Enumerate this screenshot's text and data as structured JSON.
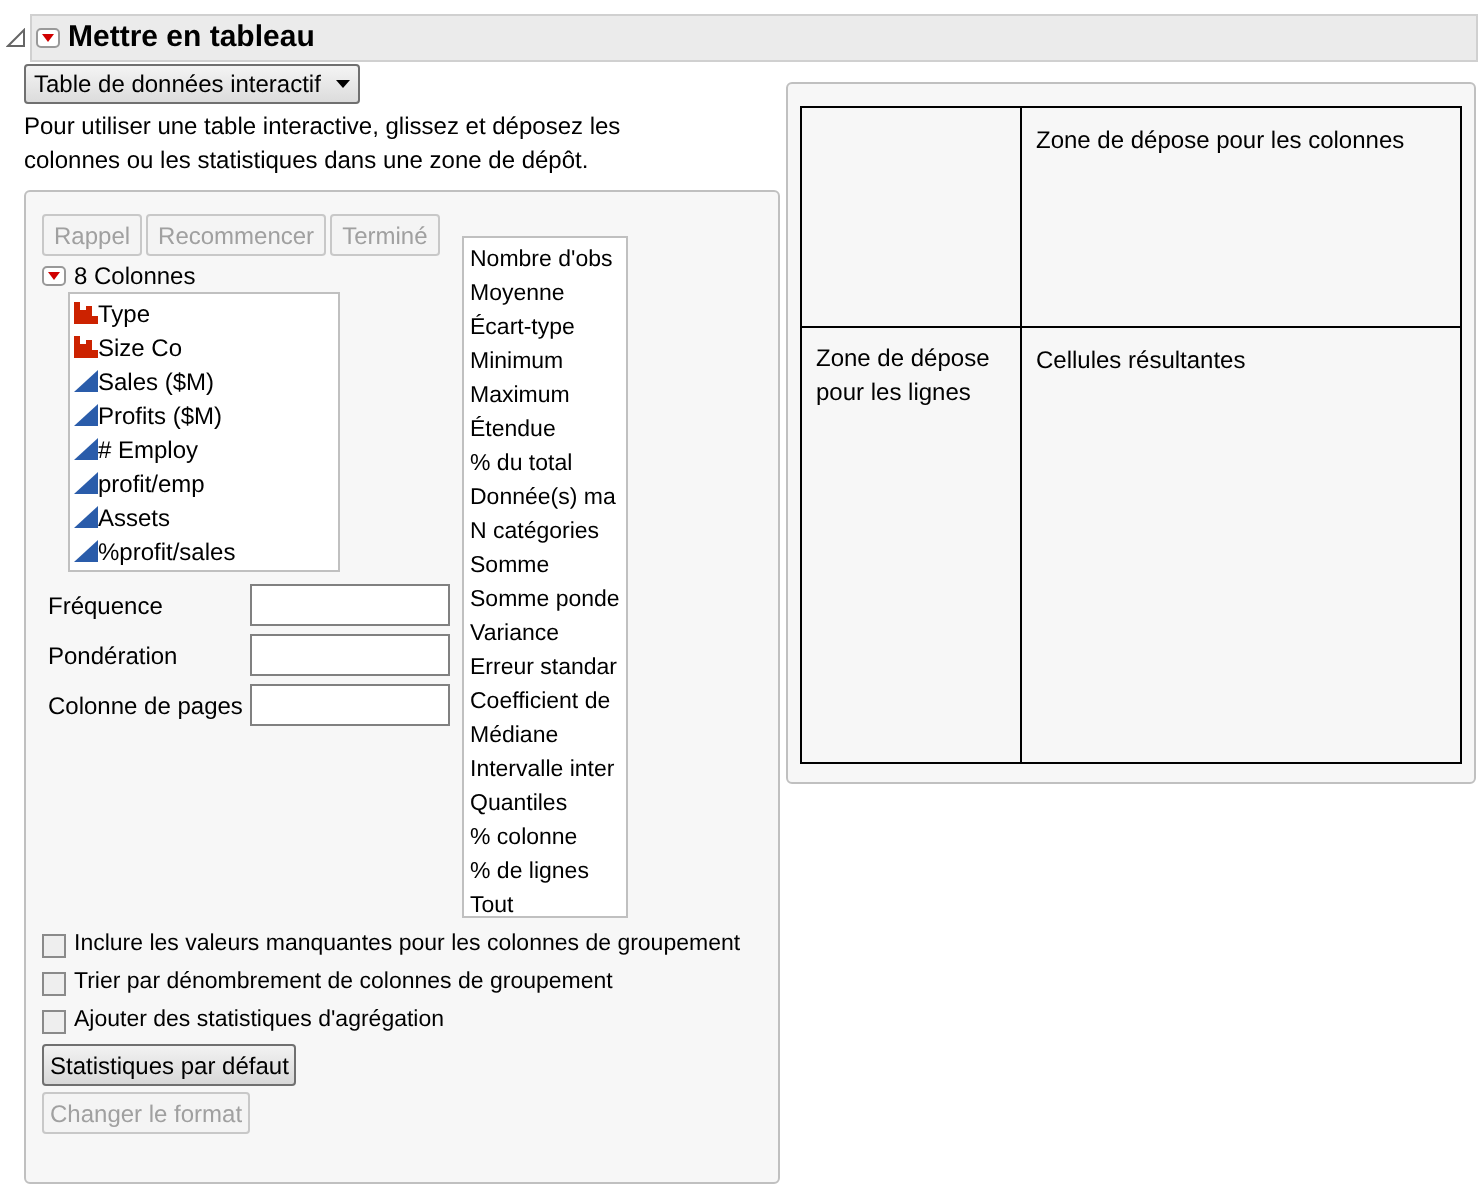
{
  "title": "Mettre en tableau",
  "mode_dropdown": {
    "value": "Table de données interactif"
  },
  "instructions": "Pour utiliser une table interactive, glissez et déposez les colonnes ou les statistiques dans une zone de dépôt.",
  "top_buttons": [
    {
      "label": "Rappel",
      "disabled": true
    },
    {
      "label": "Recommencer",
      "disabled": true
    },
    {
      "label": "Terminé",
      "disabled": true
    }
  ],
  "columns_header": "8 Colonnes",
  "columns": [
    {
      "name": "Type",
      "kind": "nominal"
    },
    {
      "name": "Size Co",
      "kind": "nominal"
    },
    {
      "name": "Sales ($M)",
      "kind": "continuous"
    },
    {
      "name": "Profits ($M)",
      "kind": "continuous"
    },
    {
      "name": "# Employ",
      "kind": "continuous"
    },
    {
      "name": "profit/emp",
      "kind": "continuous"
    },
    {
      "name": "Assets",
      "kind": "continuous"
    },
    {
      "name": "%profit/sales",
      "kind": "continuous"
    }
  ],
  "role_fields": [
    {
      "label": "Fréquence"
    },
    {
      "label": "Pondération"
    },
    {
      "label": "Colonne de pages"
    }
  ],
  "statistics": [
    "Nombre d'obs",
    "Moyenne",
    "Écart-type",
    "Minimum",
    "Maximum",
    "Étendue",
    "% du total",
    "Donnée(s) ma",
    "N catégories",
    "Somme",
    "Somme ponde",
    "Variance",
    "Erreur standar",
    "Coefficient de",
    "Médiane",
    "Intervalle inter",
    "Quantiles",
    "% colonne",
    "% de lignes",
    "Tout"
  ],
  "options": [
    {
      "label": "Inclure les valeurs manquantes pour les colonnes de groupement",
      "checked": false
    },
    {
      "label": "Trier par dénombrement de colonnes de groupement",
      "checked": false
    },
    {
      "label": "Ajouter des statistiques d'agrégation",
      "checked": false
    }
  ],
  "bottom_buttons": [
    {
      "label": "Statistiques par défaut",
      "disabled": false
    },
    {
      "label": "Changer le format",
      "disabled": true
    }
  ],
  "drop_zones": {
    "columns": "Zone de dépose pour les colonnes",
    "rows": "Zone de dépose pour les lignes",
    "results": "Cellules résultantes"
  }
}
